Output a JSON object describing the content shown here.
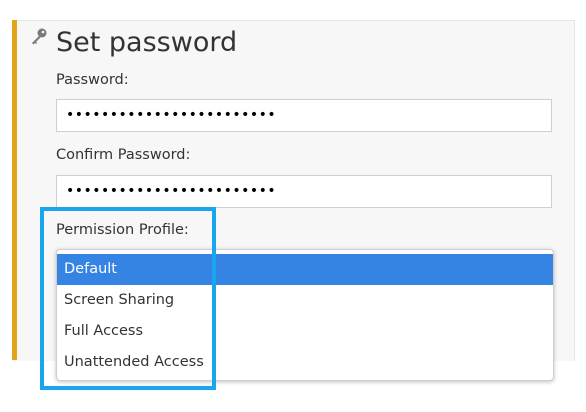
{
  "section": {
    "title": "Set password",
    "icon": "key-icon"
  },
  "password": {
    "label": "Password:",
    "value": "••••••••••••••••••••••••"
  },
  "confirm_password": {
    "label": "Confirm Password:",
    "value": "••••••••••••••••••••••••"
  },
  "permission_profile": {
    "label": "Permission Profile:",
    "options": [
      {
        "label": "Default",
        "selected": true
      },
      {
        "label": "Screen Sharing",
        "selected": false
      },
      {
        "label": "Full Access",
        "selected": false
      },
      {
        "label": "Unattended Access",
        "selected": false
      }
    ]
  },
  "colors": {
    "accent_bar": "#e0a51a",
    "selection": "#3584e4",
    "highlight": "#1aa6ef"
  }
}
